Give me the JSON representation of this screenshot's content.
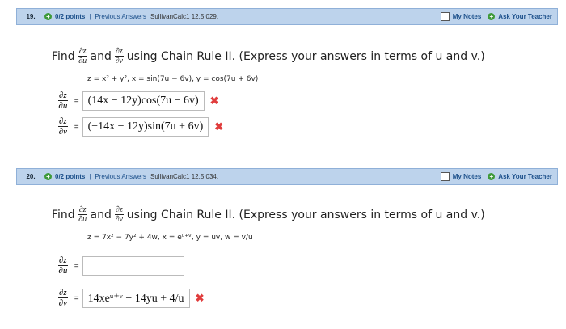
{
  "problems": [
    {
      "number": "19.",
      "points": "0/2 points",
      "sep": "|",
      "previous": "Previous Answers",
      "course": "SullivanCalc1 12.5.029.",
      "my_notes": "My Notes",
      "ask_teacher": "Ask Your Teacher",
      "instr_find": "Find",
      "instr_and": "and",
      "instr_rest": "using Chain Rule II. (Express your answers in terms of u and v.)",
      "equation": "z = x² + y²,  x = sin(7u − 6v),  y = cos(7u + 6v)",
      "dz_du_answer": "(14x − 12y)cos(7u − 6v)",
      "dz_dv_answer": "(−14x − 12y)sin(7u + 6v)",
      "dz_du_mark": "✖",
      "dz_dv_mark": "✖"
    },
    {
      "number": "20.",
      "points": "0/2 points",
      "sep": "|",
      "previous": "Previous Answers",
      "course": "SullivanCalc1 12.5.034.",
      "my_notes": "My Notes",
      "ask_teacher": "Ask Your Teacher",
      "instr_find": "Find",
      "instr_and": "and",
      "instr_rest": "using Chain Rule II. (Express your answers in terms of u and v.)",
      "equation": "z = 7x² − 7y² + 4w,  x = eᵘ⁺ᵛ,  y = uv,  w = v/u",
      "dz_du_answer": "",
      "dz_dv_answer": "14xeᵘ⁺ᵛ − 14yu + 4/u",
      "dz_dv_mark": "✖"
    }
  ],
  "partials": {
    "z": "∂z",
    "u": "∂u",
    "v": "∂v"
  },
  "equals": "=",
  "colors": {
    "header_bg": "#bdd3ec",
    "link": "#1b4f8a",
    "wrong": "#e03c3c",
    "plus_icon": "#3f9a3a"
  }
}
